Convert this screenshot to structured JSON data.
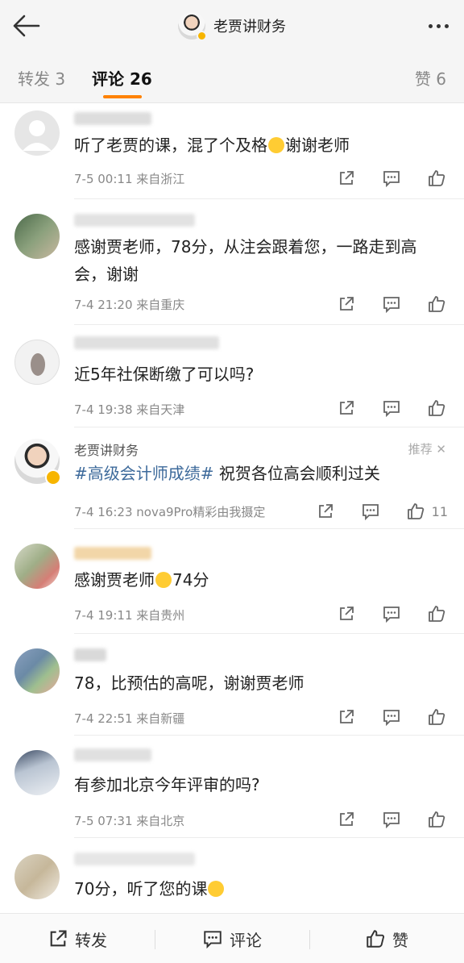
{
  "header": {
    "title": "老贾讲财务"
  },
  "tabs": {
    "forward": "转发 3",
    "comment": "评论 26",
    "like": "赞 6"
  },
  "comments": [
    {
      "text": "听了老贾的课，混了个及格",
      "text_after_emoji": "谢谢老师",
      "meta": "7-5 00:11  来自浙江"
    },
    {
      "text": "感谢贾老师，78分，从注会跟着您，一路走到高会，谢谢",
      "meta": "7-4 21:20  来自重庆"
    },
    {
      "text": "近5年社保断缴了可以吗?",
      "meta": "7-4 19:38  来自天津"
    },
    {
      "name": "老贾讲财务",
      "recommend": "推荐",
      "hashtag": "#高级会计师成绩#",
      "text": " 祝贺各位高会顺利过关",
      "meta": "7-4 16:23  nova9Pro精彩由我摄定",
      "like_count": "11"
    },
    {
      "text": "感谢贾老师",
      "text_after_emoji": "74分",
      "meta": "7-4 19:11  来自贵州"
    },
    {
      "text": "78，比预估的高呢，谢谢贾老师",
      "meta": "7-4 22:51  来自新疆"
    },
    {
      "text": "有参加北京今年评审的吗?",
      "meta": "7-5 07:31  来自北京"
    },
    {
      "text": "70分，听了您的课",
      "meta": ""
    }
  ],
  "bottom_bar": {
    "forward": "转发",
    "comment": "评论",
    "like": "赞"
  },
  "colors": {
    "accent": "#ff8200",
    "hashtag": "#3d6a9b",
    "verified_badge": "#f7b500"
  },
  "icons": [
    "back-arrow-icon",
    "more-icon",
    "share-icon",
    "comment-icon",
    "like-icon",
    "close-icon"
  ]
}
